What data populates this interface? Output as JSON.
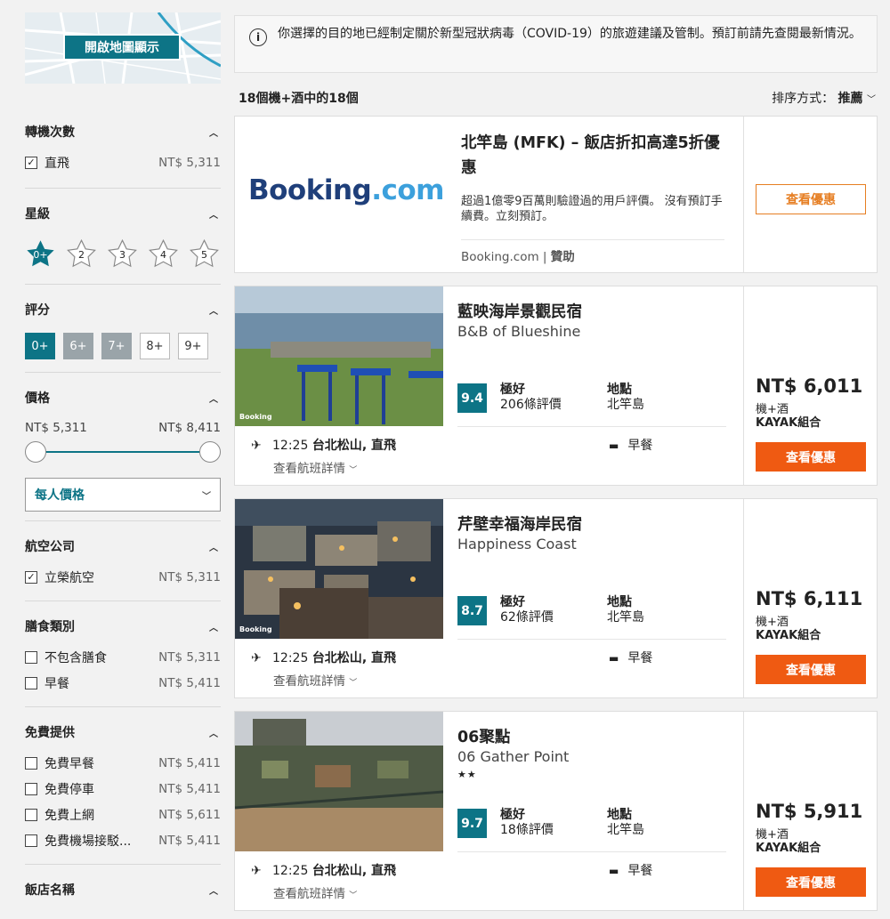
{
  "map": {
    "button": "開啟地圖顯示"
  },
  "filters": {
    "stops": {
      "title": "轉機次數",
      "items": [
        {
          "label": "直飛",
          "price": "NT$ 5,311",
          "checked": true
        }
      ]
    },
    "stars": {
      "title": "星級",
      "items": [
        "0+",
        "2",
        "3",
        "4",
        "5"
      ]
    },
    "rating": {
      "title": "評分",
      "items": [
        "0+",
        "6+",
        "7+",
        "8+",
        "9+"
      ]
    },
    "price": {
      "title": "價格",
      "min": "NT$ 5,311",
      "max": "NT$ 8,411",
      "select": "每人價格"
    },
    "airline": {
      "title": "航空公司",
      "items": [
        {
          "label": "立榮航空",
          "price": "NT$ 5,311",
          "checked": true
        }
      ]
    },
    "meal": {
      "title": "膳食類別",
      "items": [
        {
          "label": "不包含膳食",
          "price": "NT$ 5,311"
        },
        {
          "label": "早餐",
          "price": "NT$ 5,411"
        }
      ]
    },
    "free": {
      "title": "免費提供",
      "items": [
        {
          "label": "免費早餐",
          "price": "NT$ 5,411"
        },
        {
          "label": "免費停車",
          "price": "NT$ 5,411"
        },
        {
          "label": "免費上網",
          "price": "NT$ 5,611"
        },
        {
          "label": "免費機場接駁...",
          "price": "NT$ 5,411"
        }
      ]
    },
    "hotel_name": {
      "title": "飯店名稱"
    }
  },
  "notice": {
    "text": "你選擇的目的地已經制定關於新型冠狀病毒（COVID-19）的旅遊建議及管制。預訂前請先查閱最新情況。"
  },
  "results": {
    "count": "18個機+酒中的18個",
    "sort_label": "排序方式：",
    "sort_value": "推薦"
  },
  "ad": {
    "logo_a": "Booking",
    "logo_b": ".com",
    "title": "北竿島 (MFK) – 飯店折扣高達5折優惠",
    "desc": "超過1億零9百萬則驗證過的用戶評價。 沒有預訂手續費。立刻預訂。",
    "source": "Booking.com",
    "sponsor": "贊助",
    "button": "查看優惠"
  },
  "hotels": [
    {
      "name": "藍映海岸景觀民宿",
      "en": "B&B of Blueshine",
      "stars": "",
      "score": "9.4",
      "score_word": "極好",
      "reviews": "206條評價",
      "loc_label": "地點",
      "loc": "北竿島",
      "flight_time": "12:25",
      "flight_from": "台北松山",
      "flight_type": ", 直飛",
      "flight_detail": "查看航班詳情",
      "meal": "早餐",
      "price": "NT$ 6,011",
      "price_sub1": "機+酒",
      "price_sub2": "KAYAK組合",
      "button": "查看優惠",
      "watermark": "Booking"
    },
    {
      "name": "芹壁幸福海岸民宿",
      "en": "Happiness Coast",
      "stars": "",
      "score": "8.7",
      "score_word": "極好",
      "reviews": "62條評價",
      "loc_label": "地點",
      "loc": "北竿島",
      "flight_time": "12:25",
      "flight_from": "台北松山",
      "flight_type": ", 直飛",
      "flight_detail": "查看航班詳情",
      "meal": "早餐",
      "price": "NT$ 6,111",
      "price_sub1": "機+酒",
      "price_sub2": "KAYAK組合",
      "button": "查看優惠",
      "watermark": "Booking"
    },
    {
      "name": "06聚點",
      "en": "06 Gather Point",
      "stars": "★★",
      "score": "9.7",
      "score_word": "極好",
      "reviews": "18條評價",
      "loc_label": "地點",
      "loc": "北竿島",
      "flight_time": "12:25",
      "flight_from": "台北松山",
      "flight_type": ", 直飛",
      "flight_detail": "查看航班詳情",
      "meal": "早餐",
      "price": "NT$ 5,911",
      "price_sub1": "機+酒",
      "price_sub2": "KAYAK組合",
      "button": "查看優惠",
      "watermark": ""
    }
  ]
}
